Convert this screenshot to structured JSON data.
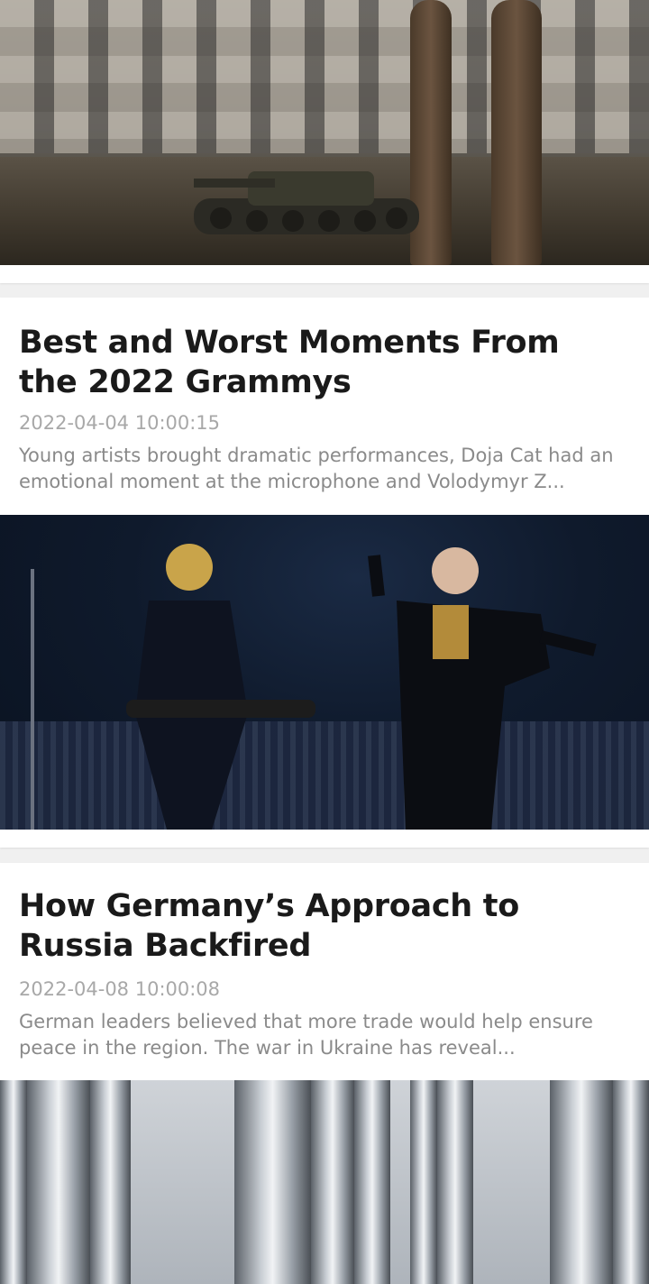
{
  "feed": {
    "articles": [
      {
        "id_label": "top-image-card",
        "image": "destroyed tank in front of damaged apartment building"
      },
      {
        "title": "Best and Worst Moments From the 2022 Grammys",
        "date": "2022-04-04 10:00:15",
        "summary": "Young artists brought dramatic performances, Doja Cat had an emotional moment at the microphone and Volodymyr Z...",
        "image": "two performers on stage with guitar and microphone"
      },
      {
        "title": "How Germany’s Approach to Russia Backfired",
        "date": "2022-04-08 10:00:08",
        "summary": "German leaders believed that more trade would help ensure peace in the region. The war in Ukraine has reveal...",
        "image": "industrial gas pipelines"
      }
    ]
  }
}
